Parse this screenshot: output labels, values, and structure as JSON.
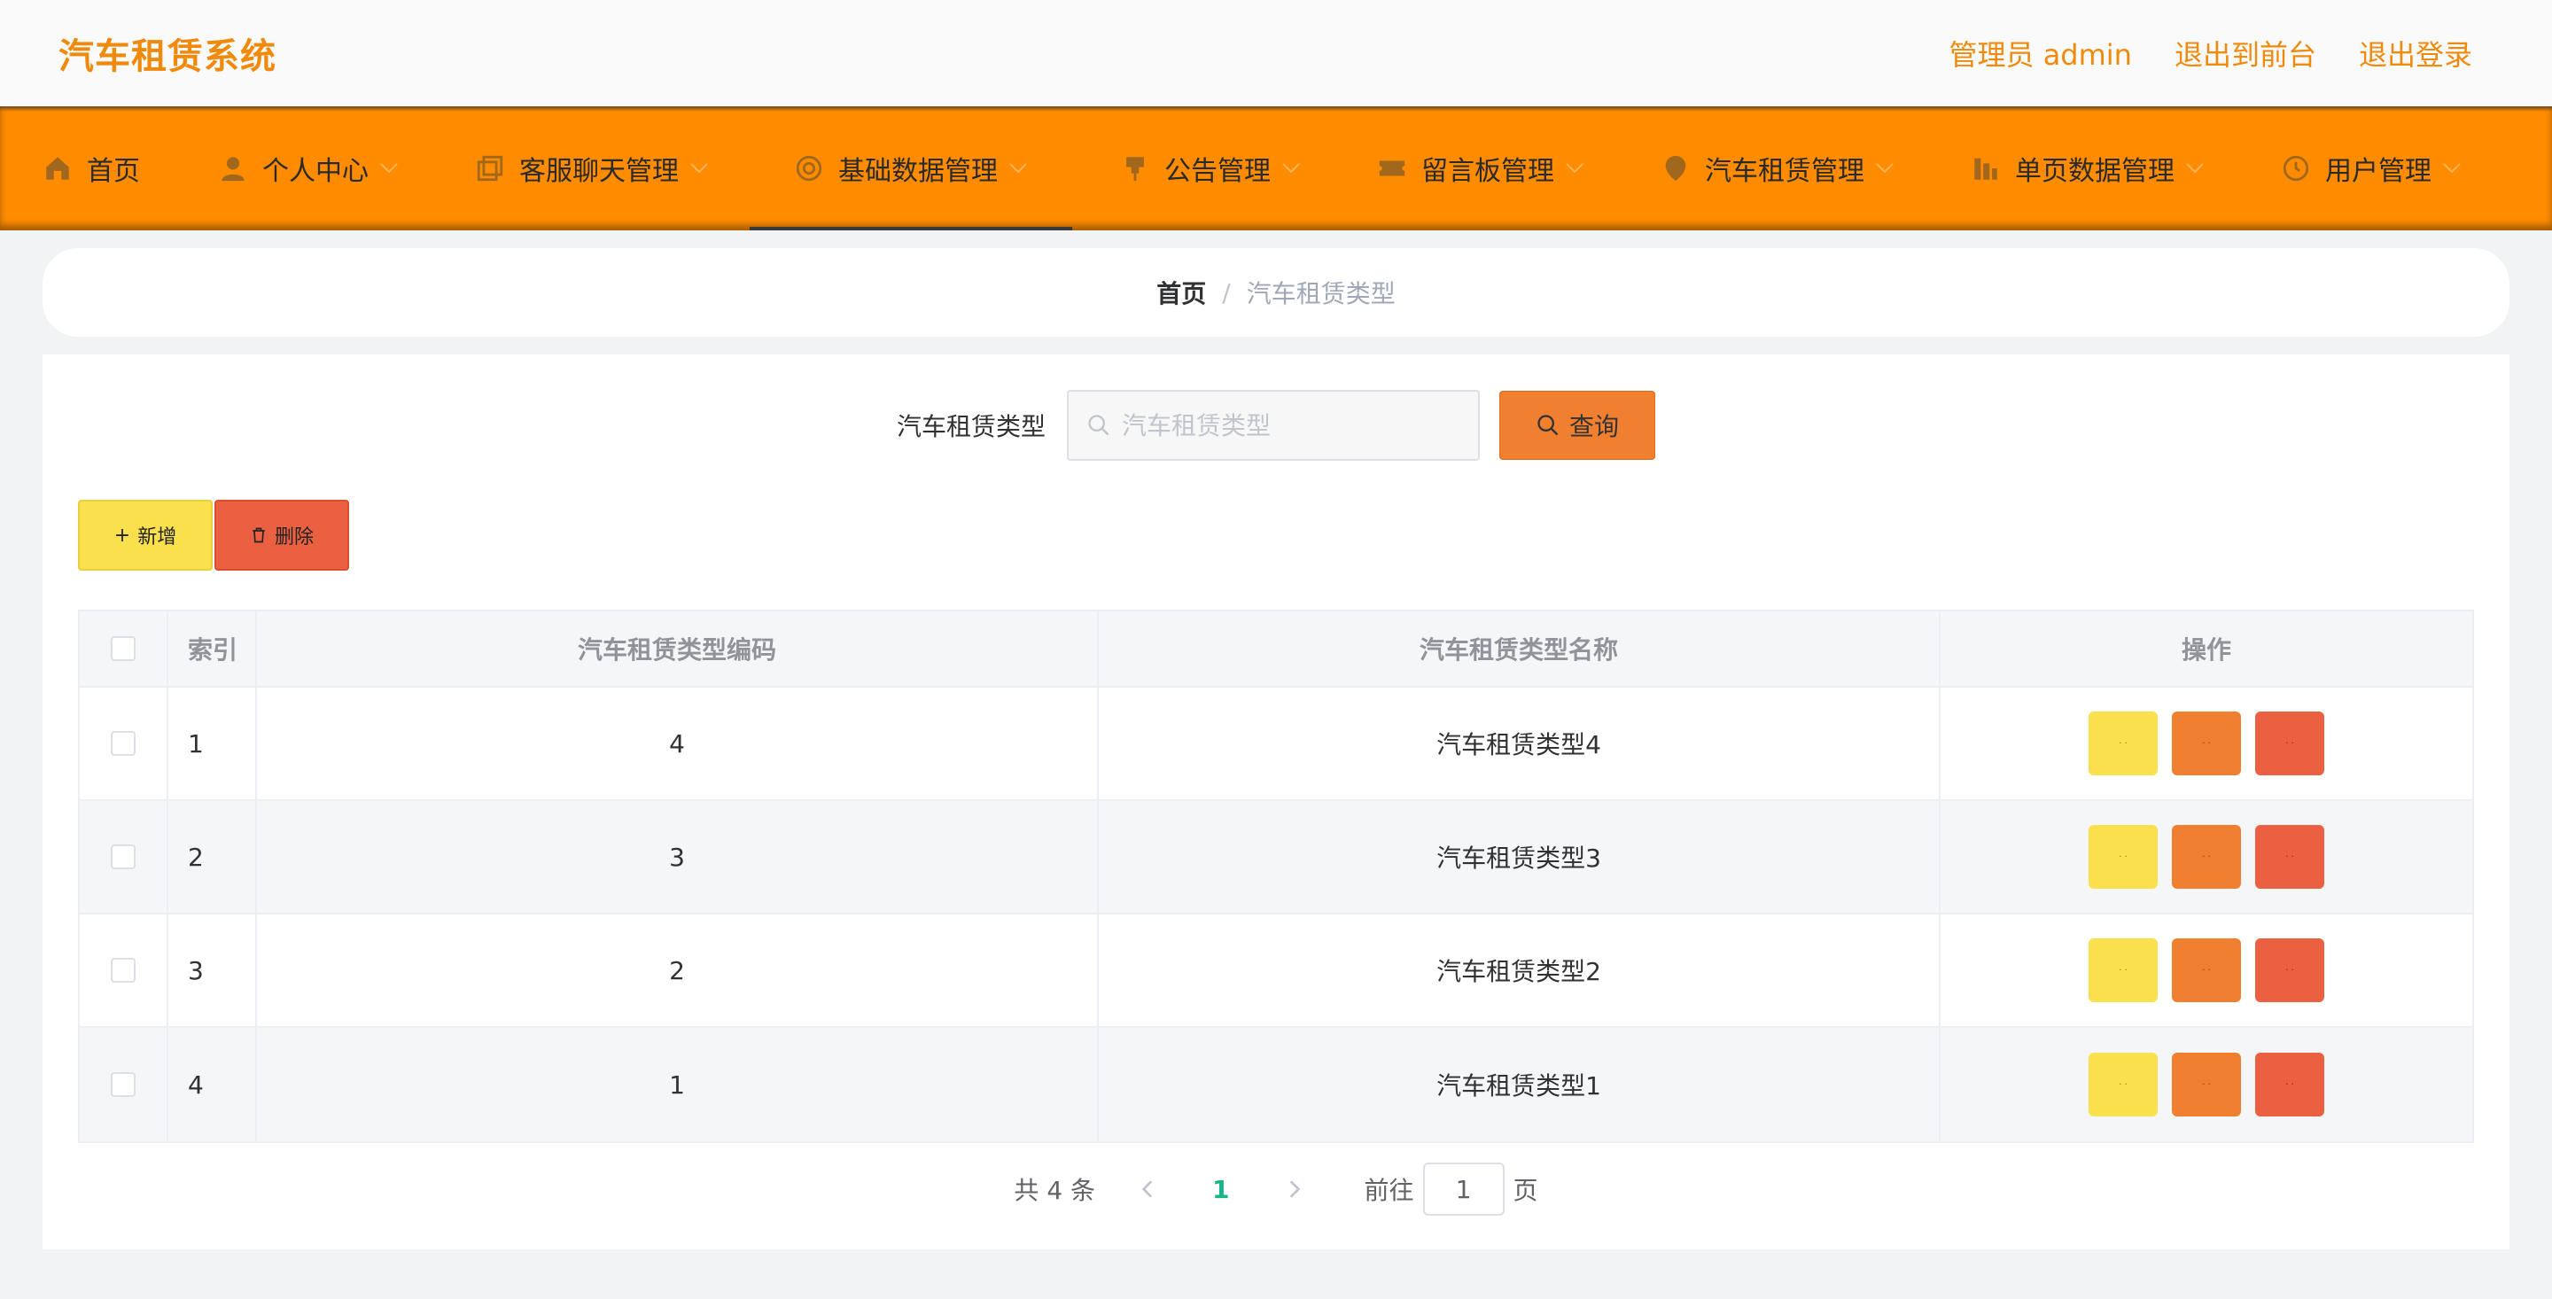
{
  "header": {
    "title": "汽车租赁系统",
    "links": [
      "管理员 admin",
      "退出到前台",
      "退出登录"
    ]
  },
  "nav": {
    "items": [
      {
        "label": "首页",
        "icon": "home-icon",
        "has_dropdown": false
      },
      {
        "label": "个人中心",
        "icon": "user-icon",
        "has_dropdown": true
      },
      {
        "label": "客服聊天管理",
        "icon": "copy-icon",
        "has_dropdown": true
      },
      {
        "label": "基础数据管理",
        "icon": "settings-icon",
        "has_dropdown": true,
        "active": true
      },
      {
        "label": "公告管理",
        "icon": "pin-icon",
        "has_dropdown": true
      },
      {
        "label": "留言板管理",
        "icon": "ticket-icon",
        "has_dropdown": true
      },
      {
        "label": "汽车租赁管理",
        "icon": "map-pin-icon",
        "has_dropdown": true
      },
      {
        "label": "单页数据管理",
        "icon": "bar-chart-icon",
        "has_dropdown": true
      },
      {
        "label": "用户管理",
        "icon": "clock-icon",
        "has_dropdown": true
      }
    ]
  },
  "breadcrumb": {
    "home": "首页",
    "separator": "/",
    "current": "汽车租赁类型"
  },
  "search": {
    "label": "汽车租赁类型",
    "placeholder": "汽车租赁类型",
    "value": "",
    "button": "查询"
  },
  "actions": {
    "add": "新增",
    "delete": "删除"
  },
  "table": {
    "columns": [
      "索引",
      "汽车租赁类型编码",
      "汽车租赁类型名称",
      "操作"
    ],
    "rows": [
      {
        "index": "1",
        "code": "4",
        "name": "汽车租赁类型4"
      },
      {
        "index": "2",
        "code": "3",
        "name": "汽车租赁类型3"
      },
      {
        "index": "3",
        "code": "2",
        "name": "汽车租赁类型2"
      },
      {
        "index": "4",
        "code": "1",
        "name": "汽车租赁类型1"
      }
    ],
    "row_button_text": "· ·"
  },
  "pagination": {
    "total": "共 4 条",
    "current_page": "1",
    "goto_prefix": "前往",
    "goto_value": "1",
    "goto_suffix": "页"
  },
  "colors": {
    "accent": "#ff8c00",
    "title": "#f08a0c",
    "yellow": "#f9e04c",
    "orange": "#f07f30",
    "red": "#ea6040",
    "page_active": "#1bb38a"
  }
}
